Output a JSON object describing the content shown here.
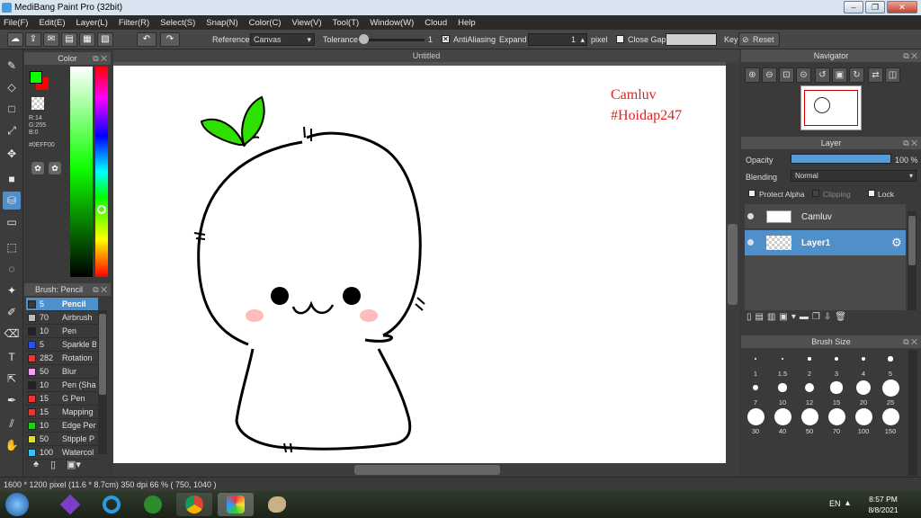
{
  "window": {
    "title": "MediBang Paint Pro (32bit)",
    "minimize": "–",
    "restore": "❐",
    "close": "✕"
  },
  "menu": [
    "File(F)",
    "Edit(E)",
    "Layer(L)",
    "Filter(R)",
    "Select(S)",
    "Snap(N)",
    "Color(C)",
    "View(V)",
    "Tool(T)",
    "Window(W)",
    "Cloud",
    "Help"
  ],
  "toolbar": {
    "reference_label": "Reference",
    "reference_value": "Canvas",
    "tolerance_label": "Tolerance",
    "tolerance_value": "1",
    "antialiasing_label": "AntiAliasing",
    "expand_label": "Expand",
    "expand_value": "1",
    "expand_unit": "pixel",
    "close_gaps_label": "Close Gaps",
    "key_label": "Key",
    "reset_label": "Reset"
  },
  "document": {
    "tab_title": "Untitled"
  },
  "color_panel": {
    "title": "Color",
    "readout": [
      "R:14",
      "G:255",
      "B:0"
    ],
    "hex": "#0EFF00",
    "foreground": "#0EFF00",
    "background": "#FF0000"
  },
  "brush_panel": {
    "title": "Brush: Pencil",
    "items": [
      {
        "size": "5",
        "name": "Pencil",
        "color": "#3a3a3a",
        "selected": true
      },
      {
        "size": "70",
        "name": "Airbrush",
        "color": "#bcbcbc"
      },
      {
        "size": "10",
        "name": "Pen",
        "color": "#222222"
      },
      {
        "size": "5",
        "name": "Sparkle B",
        "color": "#3050e0"
      },
      {
        "size": "282",
        "name": "Rotation",
        "color": "#ee3333"
      },
      {
        "size": "50",
        "name": "Blur",
        "color": "#f0a0f0"
      },
      {
        "size": "10",
        "name": "Pen (Sha",
        "color": "#222222"
      },
      {
        "size": "15",
        "name": "G Pen",
        "color": "#ee3333"
      },
      {
        "size": "15",
        "name": "Mapping",
        "color": "#ee3333"
      },
      {
        "size": "10",
        "name": "Edge Pen",
        "color": "#22cc22"
      },
      {
        "size": "50",
        "name": "Stipple P",
        "color": "#e0e020"
      },
      {
        "size": "100",
        "name": "Watercol",
        "color": "#40c0f0"
      }
    ]
  },
  "canvas_text": {
    "line1": "Camluv",
    "line2": "#Hoidap247",
    "color": "#e02020"
  },
  "navigator": {
    "title": "Navigator"
  },
  "layer_panel": {
    "title": "Layer",
    "opacity_label": "Opacity",
    "opacity_value": "100 %",
    "opacity_fraction": 1.0,
    "blending_label": "Blending",
    "blending_value": "Normal",
    "protect_alpha": "Protect Alpha",
    "clipping": "Clipping",
    "lock": "Lock",
    "layers": [
      {
        "name": "Camluv",
        "selected": false
      },
      {
        "name": "Layer1",
        "selected": true
      }
    ]
  },
  "brush_size_panel": {
    "title": "Brush Size",
    "sizes": [
      "1",
      "1.5",
      "2",
      "3",
      "4",
      "5",
      "7",
      "10",
      "12",
      "15",
      "20",
      "25",
      "30",
      "40",
      "50",
      "70",
      "100",
      "150"
    ]
  },
  "status": {
    "text": "1600 * 1200 pixel   (11.6 * 8.7cm)   350 dpi   66 %   ( 750, 1040 )"
  },
  "taskbar": {
    "lang": "EN",
    "time": "8:57 PM",
    "date": "8/8/2021"
  }
}
